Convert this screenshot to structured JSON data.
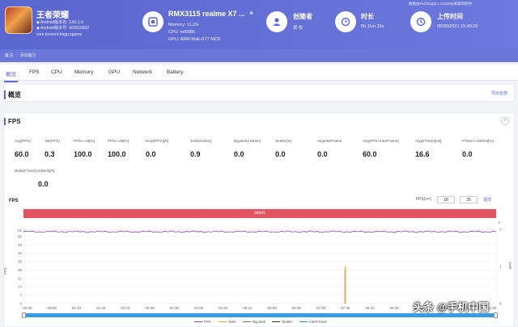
{
  "app": {
    "name": "王者荣耀",
    "android_version_label": "Android版本名:",
    "android_version_value": "3.81.1.6",
    "android_code_label": "Android版本号:",
    "android_code_value": "303010502",
    "package": "com.tencent.tmgp.sgame"
  },
  "device": {
    "title": "RMX3115 realme X7 ...",
    "memory": "Memory: 11.2G",
    "cpu": "CPU: mt6885",
    "gpu": "GPU: ARM Mali-G77 MC9"
  },
  "creator": {
    "label": "创建者",
    "value": "吴 松"
  },
  "duration": {
    "label": "时长",
    "value": "0h 11m 32s"
  },
  "upload": {
    "label": "上传时间",
    "value": "08/06/2021 15:49:20"
  },
  "version_note": "数据由PerfDog(5.1.210206)采集和提供",
  "notebar": {
    "label": "备注:",
    "value": "添加备注"
  },
  "tabs": [
    "概览",
    "FPS",
    "CPU",
    "Memory",
    "GPU",
    "Network",
    "Battery"
  ],
  "overview": {
    "title": "概览",
    "export": "导出全部"
  },
  "fps_panel": {
    "title": "FPS"
  },
  "metrics_row1": [
    {
      "label": "Avg(FPS)",
      "value": "60.0"
    },
    {
      "label": "Var(FPS)",
      "value": "0.3"
    },
    {
      "label": "FPS>=18[%]",
      "value": "100.0"
    },
    {
      "label": "FPS>=25[%]",
      "value": "100.0"
    },
    {
      "label": "Drop(FPS)[/h]",
      "value": "0.0"
    },
    {
      "label": "Jank(/10min)",
      "value": "0.9"
    },
    {
      "label": "BigJank(/10min)",
      "value": "0.0"
    },
    {
      "label": "Stutter(%)",
      "value": "0.0"
    },
    {
      "label": "AvgInterFrame",
      "value": "0.0"
    },
    {
      "label": "Avg(FPS+InterFrame)",
      "value": "60.0"
    },
    {
      "label": "Avg(FTime)[ms]",
      "value": "16.6"
    },
    {
      "label": "FTime>=100ms[%]",
      "value": "0.0"
    }
  ],
  "metrics_row2": [
    {
      "label": "Delta(FTime)>100ms[/h]",
      "value": "0.0"
    }
  ],
  "chart_header": {
    "title": "FPS",
    "range_label": "FPS(>=)",
    "range_low": "18",
    "range_high": "25",
    "apply": "更改"
  },
  "label_bar": "label1",
  "chart_data": {
    "type": "line",
    "title": "FPS",
    "ylabel": "FPS",
    "y2label": "Jank",
    "ylim": [
      0,
      62
    ],
    "y2lim": [
      0,
      2
    ],
    "yticks": [
      "61",
      "56",
      "49",
      "42",
      "35",
      "28",
      "21",
      "14",
      "7",
      "0"
    ],
    "y2ticks": [
      "2",
      "1",
      "0"
    ],
    "xticks": [
      "00:00",
      "00:35",
      "01:10",
      "01:45",
      "02:20",
      "02:55",
      "03:30",
      "04:05",
      "04:40",
      "05:15",
      "05:50",
      "06:25",
      "07:00",
      "07:35",
      "08:10",
      "08:45",
      "09:20",
      "09:55",
      "10:30",
      "11:05"
    ],
    "series": [
      {
        "name": "FPS",
        "color": "#8e44ad",
        "description_values": "steady near 60"
      },
      {
        "name": "Jank",
        "color": "#e0a030"
      },
      {
        "name": "BigJank",
        "color": "#777777"
      },
      {
        "name": "Stutter",
        "color": "#333333"
      },
      {
        "name": "InterFrame",
        "color": "#2a9d8f"
      }
    ],
    "fps_baseline": 60,
    "jank_event": {
      "time": "07:35",
      "value": 1
    }
  },
  "legend": [
    "FPS",
    "Jank",
    "BigJank",
    "Stutter",
    "InterFrame"
  ],
  "colors": {
    "accent": "#5a66cf",
    "label_bar": "#e25560",
    "fps_line": "#8e44ad",
    "jank": "#e0a030"
  },
  "watermark": "头条 @手机中国"
}
